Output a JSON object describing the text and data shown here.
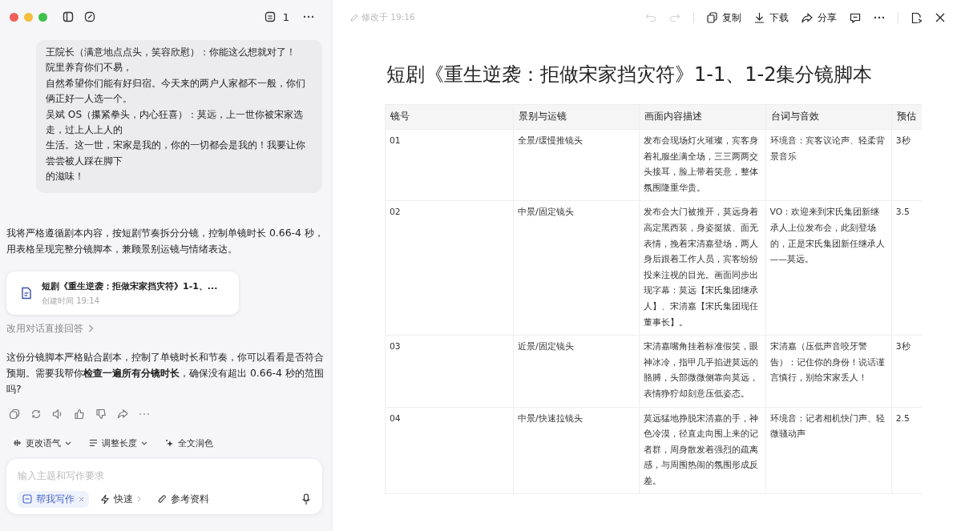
{
  "sidebar": {
    "badge_count": "1"
  },
  "chat": {
    "bubble_paragraphs": [
      "王院长（满意地点点头，笑容欣慰）：你能这么想就对了！",
      "院里养育你们不易，",
      "自然希望你们能有好归宿。今天来的两户人家都不一般，你们俩正好一人选一个。",
      "吴斌 OS（攥紧拳头，内心狂喜）：莫远，上一世你被宋家选走，过上人上人的",
      "生活。这一世，宋家是我的，你的一切都会是我的！我要让你尝尝被人踩在脚下",
      "的滋味！"
    ],
    "intro": "我将严格遵循剧本内容，按短剧节奏拆分分镜，控制单镜时长 0.66-4 秒，用表格呈现完整分镜脚本，兼顾景别运镜与情绪表达。",
    "file_card": {
      "title": "短剧《重生逆袭：拒做宋家挡灾符》1-1、...",
      "meta": "创建时间 19:14"
    },
    "switch_link": "改用对话直接回答",
    "reply": "这份分镜脚本严格贴合剧本，控制了单镜时长和节奏，你可以看看是否符合预期。需要我帮你**检查一遍所有分镜时长**，确保没有超出 0.66-4 秒的范围吗?"
  },
  "tone_tools": [
    {
      "label": "更改语气",
      "kind": "tone"
    },
    {
      "label": "调整长度",
      "kind": "length"
    },
    {
      "label": "全文润色",
      "kind": "polish"
    }
  ],
  "composer": {
    "placeholder": "输入主题和写作要求",
    "chips": [
      {
        "label": "帮我写作",
        "kind": "mode",
        "selected": true
      },
      {
        "label": "快速",
        "kind": "speed",
        "selected": false
      },
      {
        "label": "参考资料",
        "kind": "attach",
        "selected": false
      }
    ]
  },
  "document": {
    "modified": "修改于 19:16",
    "undo_disabled": true,
    "actions": [
      {
        "label": "复制",
        "kind": "copy"
      },
      {
        "label": "下载",
        "kind": "download"
      },
      {
        "label": "分享",
        "kind": "share"
      }
    ],
    "title": "短剧《重生逆袭：拒做宋家挡灾符》1-1、1-2集分镜脚本",
    "table": {
      "columns": [
        "镜号",
        "景别与运镜",
        "画面内容描述",
        "台词与音效",
        "预估"
      ],
      "rows": [
        [
          "01",
          "全景/缓慢推镜头",
          "发布会现场灯火璀璨，宾客身着礼服坐满全场，三三两两交头接耳，脸上带着笑意，整体氛围隆重华贵。",
          "环境音：宾客议论声、轻柔背景音乐",
          "3秒"
        ],
        [
          "02",
          "中景/固定镜头",
          "发布会大门被推开，莫远身着高定黑西装，身姿挺拔、面无表情，挽着宋清嘉登场，两人身后跟着工作人员，宾客纷纷投来注视的目光。画面同步出现字幕：莫远【宋氏集团继承人】、宋清嘉【宋氏集团现任董事长】。",
          "VO：欢迎来到宋氏集团新继承人上位发布会，此刻登场的，正是宋氏集团新任继承人——莫远。",
          "3.5"
        ],
        [
          "03",
          "近景/固定镜头",
          "宋清嘉嘴角挂着标准假笑，眼神冰冷，指甲几乎掐进莫远的胳膊，头部微微侧靠向莫远，表情狰狞却刻意压低姿态。",
          "宋清嘉（压低声音咬牙警告）：记住你的身份！说话谨言慎行，别给宋家丢人！",
          "3秒"
        ],
        [
          "04",
          "中景/快速拉镜头",
          "莫远猛地挣脱宋清嘉的手，神色冷漠，径直走向围上来的记者群，周身散发着强烈的疏离感，与周围热闹的氛围形成反差。",
          "环境音：记者相机快门声、轻微骚动声",
          "2.5"
        ]
      ]
    }
  }
}
